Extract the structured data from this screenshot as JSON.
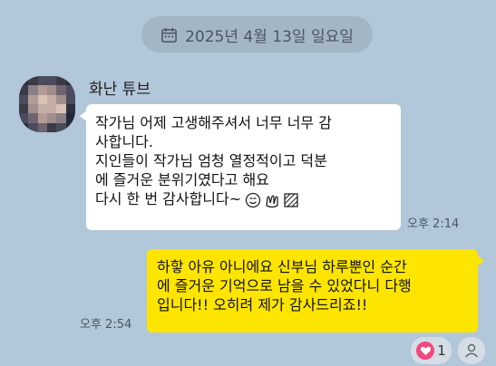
{
  "date_divider": {
    "text": "2025년 4월 13일 일요일",
    "icon": "calendar-icon"
  },
  "messages": [
    {
      "direction": "incoming",
      "sender": "화난 튜브",
      "lines": [
        "작가님 어제 고생해주셔서 너무 너무 감",
        "사합니다.",
        "지인들이 작가님 엄청 열정적이고 덕분",
        "에 즐거운 분위기였다고 해요",
        "다시 한 번 감사합니다~"
      ],
      "emojis": [
        "smiling-face-icon",
        "clapping-hands-icon",
        "striped-flag-icon"
      ],
      "time": "오후 2:14"
    },
    {
      "direction": "outgoing",
      "lines": [
        "하핳 아유 아니에요 신부님 하루뿐인 순간",
        "에 즐거운 기억으로 남을 수 있었다니 다행",
        "입니다!! 오히려 제가 감사드리죠!!"
      ],
      "time": "오후 2:54"
    }
  ],
  "reaction": {
    "icon": "heart-icon",
    "count": "1"
  },
  "readers_icon": "person-icon",
  "colors": {
    "background": "#b2c7d9",
    "incoming_bubble": "#ffffff",
    "outgoing_bubble": "#fee500",
    "heart": "#f04a7f"
  }
}
